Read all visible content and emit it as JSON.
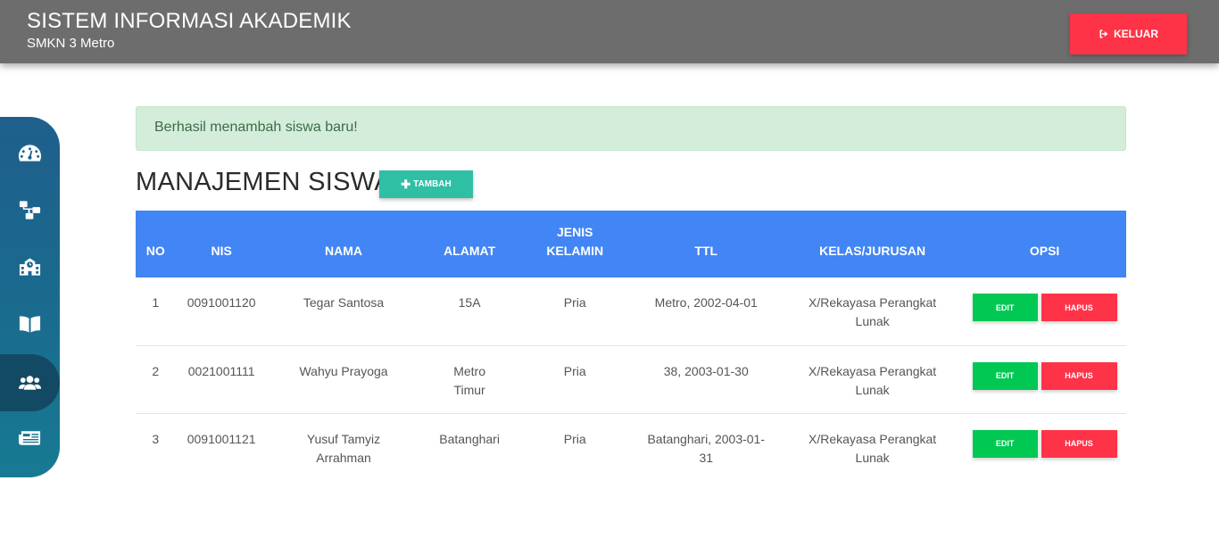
{
  "header": {
    "title": "SISTEM INFORMASI AKADEMIK",
    "subtitle": "SMKN 3 Metro",
    "logout_label": "KELUAR",
    "accent": "#ff3347"
  },
  "sidebar": {
    "items": [
      {
        "icon": "dashboard-icon",
        "active": false
      },
      {
        "icon": "sitemap-icon",
        "active": false
      },
      {
        "icon": "school-icon",
        "active": false
      },
      {
        "icon": "book-icon",
        "active": false
      },
      {
        "icon": "users-icon",
        "active": true
      },
      {
        "icon": "newspaper-icon",
        "active": false
      }
    ]
  },
  "alert": {
    "message": "Berhasil menambah siswa baru!"
  },
  "main": {
    "title": "MANAJEMEN SISWA",
    "add_label": "TAMBAH"
  },
  "table": {
    "headers": [
      "NO",
      "NIS",
      "NAMA",
      "ALAMAT",
      "JENIS KELAMIN",
      "TTL",
      "KELAS/JURUSAN",
      "OPSI"
    ],
    "rows": [
      {
        "no": "1",
        "nis": "0091001120",
        "nama": "Tegar Santosa",
        "alamat": "15A",
        "jk": "Pria",
        "ttl": "Metro, 2002-04-01",
        "kelas": "X/Rekayasa Perangkat Lunak"
      },
      {
        "no": "2",
        "nis": "0021001111",
        "nama": "Wahyu Prayoga",
        "alamat": "Metro Timur",
        "jk": "Pria",
        "ttl": "38, 2003-01-30",
        "kelas": "X/Rekayasa Perangkat Lunak"
      },
      {
        "no": "3",
        "nis": "0091001121",
        "nama": "Yusuf Tamyiz Arrahman",
        "alamat": "Batanghari",
        "jk": "Pria",
        "ttl": "Batanghari, 2003-01-31",
        "kelas": "X/Rekayasa Perangkat Lunak"
      }
    ],
    "edit_label": "EDIT",
    "delete_label": "HAPUS"
  }
}
